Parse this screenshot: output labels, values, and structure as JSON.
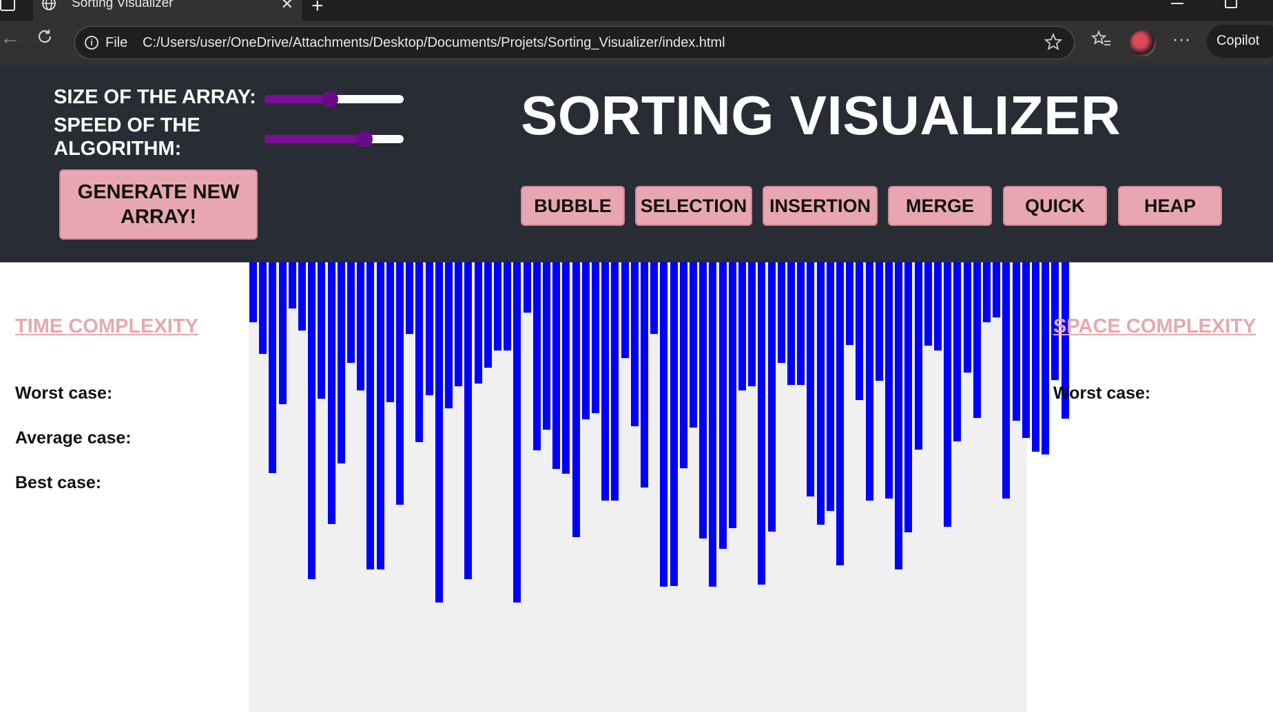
{
  "browser": {
    "tab_title": "Sorting Visualizer",
    "new_tab_symbol": "+",
    "close_symbol": "✕",
    "address_scheme_label": "File",
    "url": "C:/Users/user/OneDrive/Attachments/Desktop/Documents/Projets/Sorting_Visualizer/index.html",
    "copilot_label": "Copilot",
    "more_symbol": "···"
  },
  "controls": {
    "size_label": "SIZE OF THE ARRAY:",
    "speed_label": "SPEED OF THE ALGORITHM:",
    "size_slider_value_fraction": 0.47,
    "speed_slider_value_fraction": 0.72,
    "generate_button_label": "GENERATE NEW ARRAY!"
  },
  "header": {
    "title": "SORTING VISUALIZER"
  },
  "algorithms": [
    "BUBBLE",
    "SELECTION",
    "INSERTION",
    "MERGE",
    "QUICK",
    "HEAP"
  ],
  "time_complexity": {
    "heading": "TIME COMPLEXITY",
    "worst_label": "Worst case:",
    "average_label": "Average case:",
    "best_label": "Best case:"
  },
  "space_complexity": {
    "heading": "SPACE COMPLEXITY",
    "worst_label": "Worst case:"
  },
  "array_values": [
    87,
    133,
    306,
    206,
    67,
    99,
    460,
    198,
    380,
    292,
    146,
    186,
    446,
    446,
    203,
    352,
    104,
    261,
    193,
    494,
    212,
    180,
    460,
    176,
    153,
    128,
    128,
    494,
    73,
    273,
    243,
    300,
    307,
    399,
    228,
    219,
    346,
    346,
    139,
    238,
    327,
    104,
    471,
    470,
    299,
    240,
    401,
    471,
    416,
    386,
    186,
    180,
    468,
    391,
    146,
    178,
    178,
    340,
    381,
    361,
    440,
    120,
    200,
    346,
    172,
    343,
    446,
    392,
    272,
    121,
    128,
    384,
    260,
    160,
    226,
    87,
    80,
    343,
    230,
    255,
    275,
    279,
    171,
    227
  ],
  "colors": {
    "bar": "#0000ff",
    "accent_pink": "#e8a7b0",
    "header_bg": "#282c34",
    "slider_fill": "#7a0e99"
  }
}
